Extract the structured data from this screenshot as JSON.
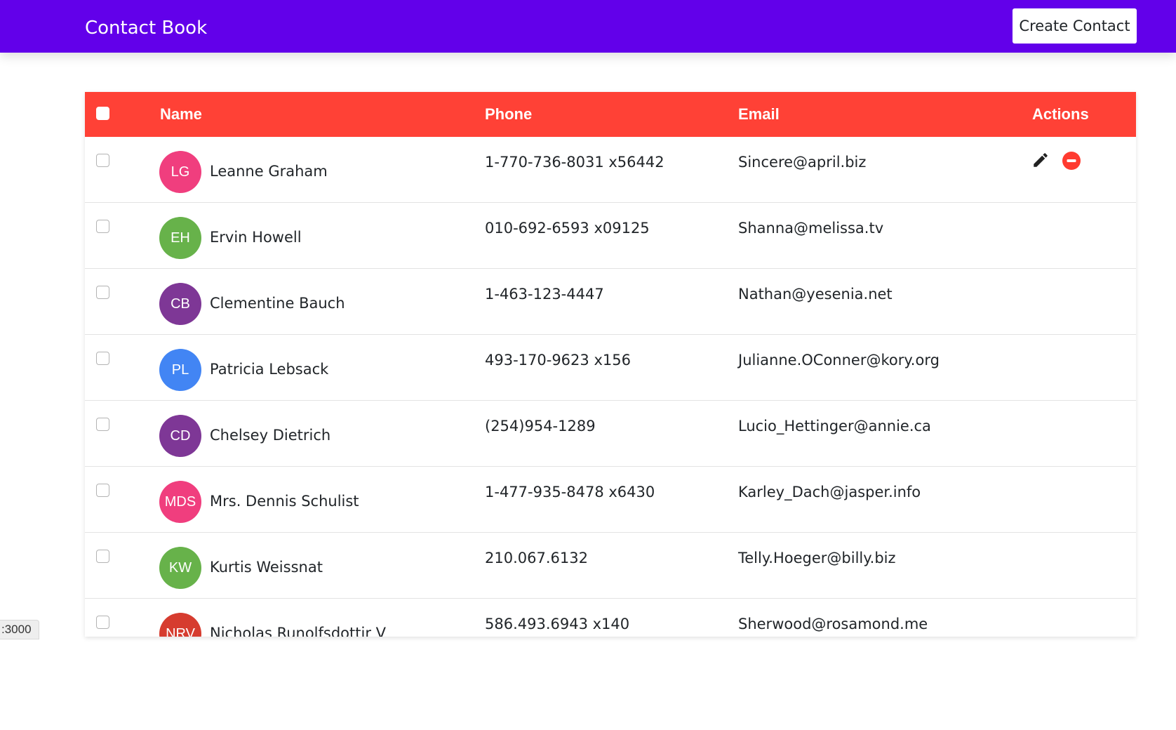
{
  "app": {
    "brand": "Contact Book",
    "create_label": "Create Contact"
  },
  "table": {
    "headers": {
      "name": "Name",
      "phone": "Phone",
      "email": "Email",
      "actions": "Actions"
    },
    "rows": [
      {
        "initials": "LG",
        "name": "Leanne Graham",
        "phone": "1-770-736-8031 x56442",
        "email": "Sincere@april.biz",
        "avatar_color": "#f03e7e"
      },
      {
        "initials": "EH",
        "name": "Ervin Howell",
        "phone": "010-692-6593 x09125",
        "email": "Shanna@melissa.tv",
        "avatar_color": "#67b24a"
      },
      {
        "initials": "CB",
        "name": "Clementine Bauch",
        "phone": "1-463-123-4447",
        "email": "Nathan@yesenia.net",
        "avatar_color": "#7e3796"
      },
      {
        "initials": "PL",
        "name": "Patricia Lebsack",
        "phone": "493-170-9623 x156",
        "email": "Julianne.OConner@kory.org",
        "avatar_color": "#4285f4"
      },
      {
        "initials": "CD",
        "name": "Chelsey Dietrich",
        "phone": "(254)954-1289",
        "email": "Lucio_Hettinger@annie.ca",
        "avatar_color": "#7e3796"
      },
      {
        "initials": "MDS",
        "name": "Mrs. Dennis Schulist",
        "phone": "1-477-935-8478 x6430",
        "email": "Karley_Dach@jasper.info",
        "avatar_color": "#f03e7e"
      },
      {
        "initials": "KW",
        "name": "Kurtis Weissnat",
        "phone": "210.067.6132",
        "email": "Telly.Hoeger@billy.biz",
        "avatar_color": "#67b24a"
      },
      {
        "initials": "NRV",
        "name": "Nicholas Runolfsdottir V",
        "phone": "586.493.6943 x140",
        "email": "Sherwood@rosamond.me",
        "avatar_color": "#d63c2f"
      }
    ]
  },
  "status_bar": {
    "url_text": ":3000"
  },
  "colors": {
    "navbar": "#6200ea",
    "table_header": "#ff4136",
    "delete_icon": "#ff3b30"
  },
  "icons": {
    "edit": "pencil-icon",
    "delete": "minus-circle-icon"
  }
}
